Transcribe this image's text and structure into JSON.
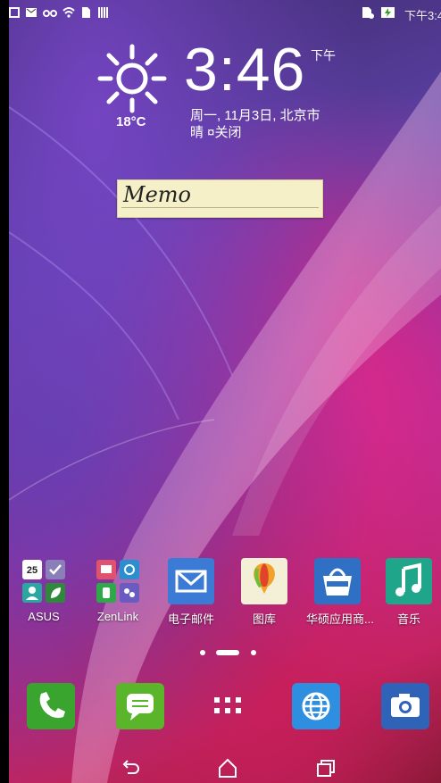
{
  "status_bar": {
    "time_text": "下午3:4"
  },
  "clock": {
    "time": "3:46",
    "ampm": "下午",
    "date": "周一, 11月3日, 北京市",
    "weather_alarm": "晴 ¤关闭",
    "temperature": "18°C"
  },
  "memo": {
    "text": "Memo"
  },
  "apps": [
    {
      "label": "ASUS",
      "icon": "asus-folder-icon"
    },
    {
      "label": "ZenLink",
      "icon": "zenlink-folder-icon"
    },
    {
      "label": "电子邮件",
      "icon": "email-icon"
    },
    {
      "label": "图库",
      "icon": "gallery-icon"
    },
    {
      "label": "华硕应用商...",
      "icon": "asus-store-icon"
    },
    {
      "label": "音乐",
      "icon": "music-icon"
    }
  ],
  "folder_asus": {
    "calendar_date": "25"
  },
  "dock": [
    {
      "icon": "phone-icon"
    },
    {
      "icon": "messages-icon"
    },
    {
      "icon": "app-drawer-icon"
    },
    {
      "icon": "browser-icon"
    },
    {
      "icon": "camera-icon"
    }
  ],
  "nav": [
    {
      "icon": "back-icon"
    },
    {
      "icon": "home-icon"
    },
    {
      "icon": "recents-icon"
    }
  ],
  "colors": {
    "email_blue": "#3b7bd6",
    "phone_green": "#3aa52e",
    "messages_green": "#5bb52a",
    "browser_blue": "#2e8fe0",
    "camera_blue": "#2f63b8",
    "music_teal": "#1fa58a"
  }
}
